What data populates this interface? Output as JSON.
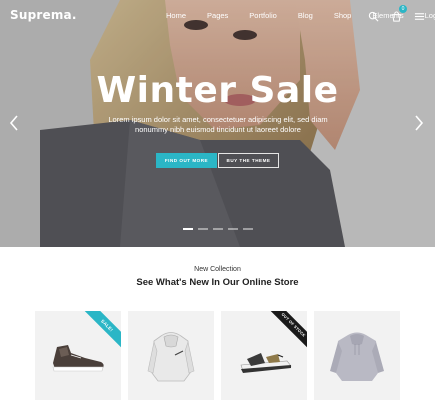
{
  "header": {
    "logo": "Suprema.",
    "nav": [
      "Home",
      "Pages",
      "Portfolio",
      "Blog",
      "Shop",
      "Elements"
    ],
    "login": "Login",
    "cart_count": "0",
    "icons": [
      "search-icon",
      "cart-icon",
      "menu-icon"
    ]
  },
  "hero": {
    "title": "Winter Sale",
    "subtitle": "Lorem ipsum dolor sit amet, consectetuer adipiscing elit, sed diam nonummy nibh euismod tincidunt ut laoreet dolore",
    "primary_button": "FIND OUT MORE",
    "secondary_button": "BUY THE THEME",
    "slide_count": 5,
    "active_slide": 1
  },
  "collection": {
    "kicker": "New Collection",
    "title": "See What's New In Our Online Store",
    "products": [
      {
        "name": "sneaker",
        "badge": "SALE!"
      },
      {
        "name": "hoodie",
        "badge": ""
      },
      {
        "name": "sandal",
        "badge": "OUT OF STOCK"
      },
      {
        "name": "sweatshirt",
        "badge": ""
      }
    ]
  },
  "colors": {
    "accent": "#2bb6c6",
    "dark_badge": "#1a1a1a",
    "card_bg": "#f2f2f2"
  }
}
